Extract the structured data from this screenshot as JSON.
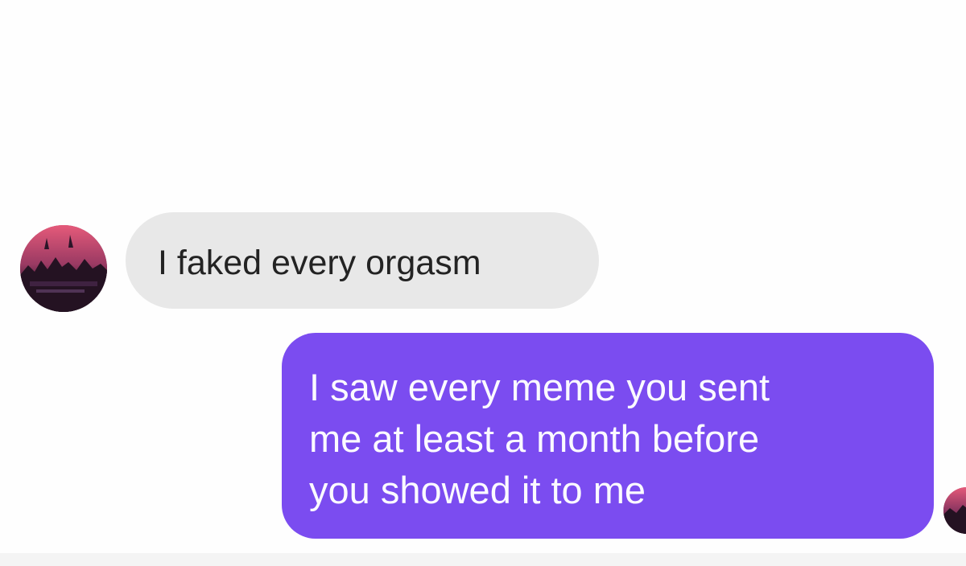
{
  "conversation": {
    "messages": [
      {
        "direction": "incoming",
        "text": "I faked every orgasm",
        "avatar_icon": "contact-avatar"
      },
      {
        "direction": "outgoing",
        "lines": [
          "I saw every meme you sent",
          "me at least a month before",
          "you showed it to me"
        ],
        "read_receipt_icon": "seen-avatar"
      }
    ]
  },
  "colors": {
    "incoming_bubble": "#e8e8e8",
    "outgoing_bubble": "#7b4cf0",
    "background": "#fefefe"
  }
}
